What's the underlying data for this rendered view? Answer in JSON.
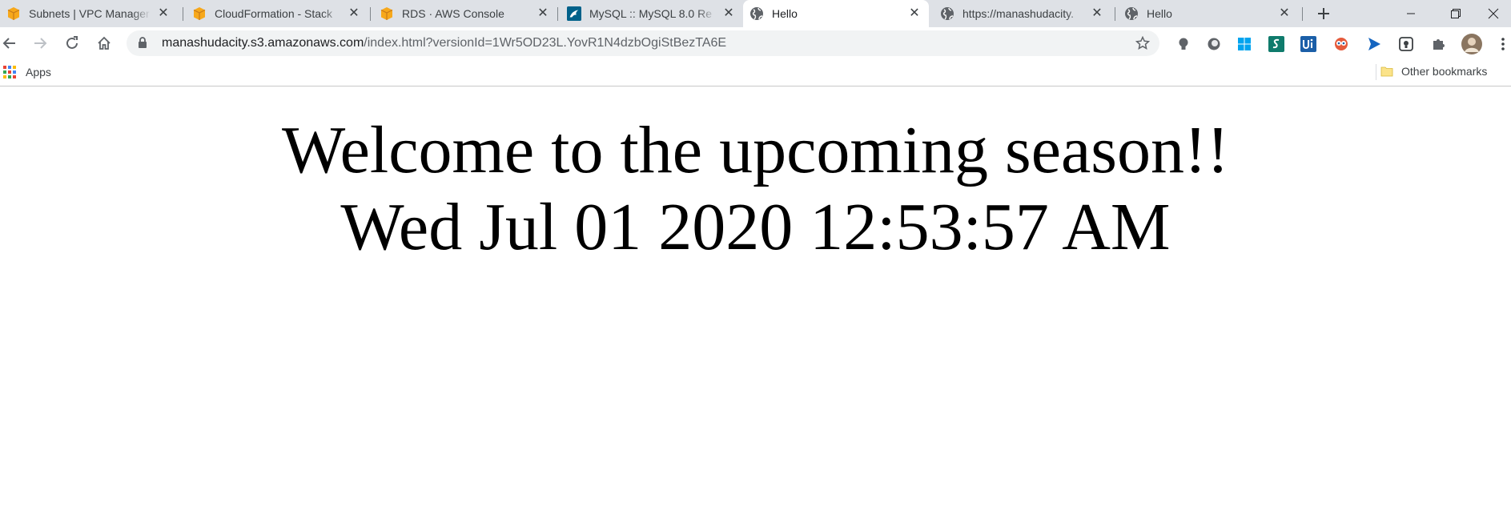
{
  "tabs": [
    {
      "title": "Subnets | VPC Manager",
      "favicon": "aws-box-icon",
      "active": false
    },
    {
      "title": "CloudFormation - Stack",
      "favicon": "aws-box-icon",
      "active": false
    },
    {
      "title": "RDS · AWS Console",
      "favicon": "aws-box-icon",
      "active": false
    },
    {
      "title": "MySQL :: MySQL 8.0 Re",
      "favicon": "mysql-dolphin-icon",
      "active": false
    },
    {
      "title": "Hello",
      "favicon": "globe-icon",
      "active": true
    },
    {
      "title": "https://manashudacity.",
      "favicon": "globe-icon",
      "active": false
    },
    {
      "title": "Hello",
      "favicon": "globe-icon",
      "active": false
    }
  ],
  "address_bar": {
    "host": "manashudacity.s3.amazonaws.com",
    "path": "/index.html?versionId=1Wr5OD23L.YovR1N4dzbOgiStBezTA6E"
  },
  "bookmarks": {
    "apps_label": "Apps",
    "other_label": "Other bookmarks"
  },
  "page": {
    "line1": "Welcome to the upcoming season!!",
    "line2": "Wed Jul 01 2020 12:53:57 AM"
  },
  "colors": {
    "tabstrip_bg": "#dee1e6",
    "aws_orange": "#f7a81b",
    "omnibox_bg": "#f1f3f4"
  }
}
